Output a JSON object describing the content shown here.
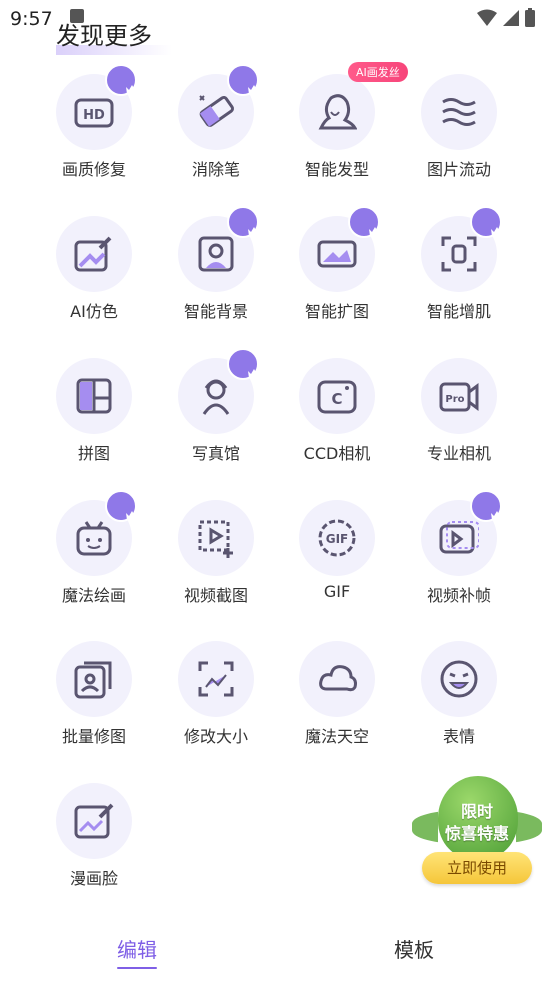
{
  "status_bar": {
    "time": "9:57"
  },
  "page_title": "发现更多",
  "ai_tag": "AI画发丝",
  "tools": [
    {
      "label": "画质修复",
      "icon": "hd-icon",
      "vip": true
    },
    {
      "label": "消除笔",
      "icon": "eraser-icon",
      "vip": true
    },
    {
      "label": "智能发型",
      "icon": "hairstyle-icon",
      "vip": false
    },
    {
      "label": "图片流动",
      "icon": "flow-icon",
      "vip": false
    },
    {
      "label": "AI仿色",
      "icon": "color-picker-icon",
      "vip": false
    },
    {
      "label": "智能背景",
      "icon": "background-icon",
      "vip": true
    },
    {
      "label": "智能扩图",
      "icon": "expand-icon",
      "vip": true
    },
    {
      "label": "智能增肌",
      "icon": "muscle-icon",
      "vip": true
    },
    {
      "label": "拼图",
      "icon": "collage-icon",
      "vip": false
    },
    {
      "label": "写真馆",
      "icon": "portrait-icon",
      "vip": true
    },
    {
      "label": "CCD相机",
      "icon": "ccd-camera-icon",
      "vip": false
    },
    {
      "label": "专业相机",
      "icon": "pro-camera-icon",
      "vip": false
    },
    {
      "label": "魔法绘画",
      "icon": "robot-icon",
      "vip": true
    },
    {
      "label": "视频截图",
      "icon": "video-crop-icon",
      "vip": false
    },
    {
      "label": "GIF",
      "icon": "gif-icon",
      "vip": false
    },
    {
      "label": "视频补帧",
      "icon": "video-frame-icon",
      "vip": true
    },
    {
      "label": "批量修图",
      "icon": "batch-icon",
      "vip": false
    },
    {
      "label": "修改大小",
      "icon": "resize-icon",
      "vip": false
    },
    {
      "label": "魔法天空",
      "icon": "cloud-icon",
      "vip": false
    },
    {
      "label": "表情",
      "icon": "emoji-icon",
      "vip": false
    },
    {
      "label": "漫画脸",
      "icon": "comic-face-icon",
      "vip": false
    }
  ],
  "promo": {
    "line1": "限时",
    "line2": "惊喜特惠",
    "button": "立即使用"
  },
  "tabs": {
    "edit": "编辑",
    "template": "模板"
  },
  "colors": {
    "accent": "#7f5fe6",
    "circle_bg": "#f2f1fc",
    "crown_bg": "#8f78e8"
  }
}
